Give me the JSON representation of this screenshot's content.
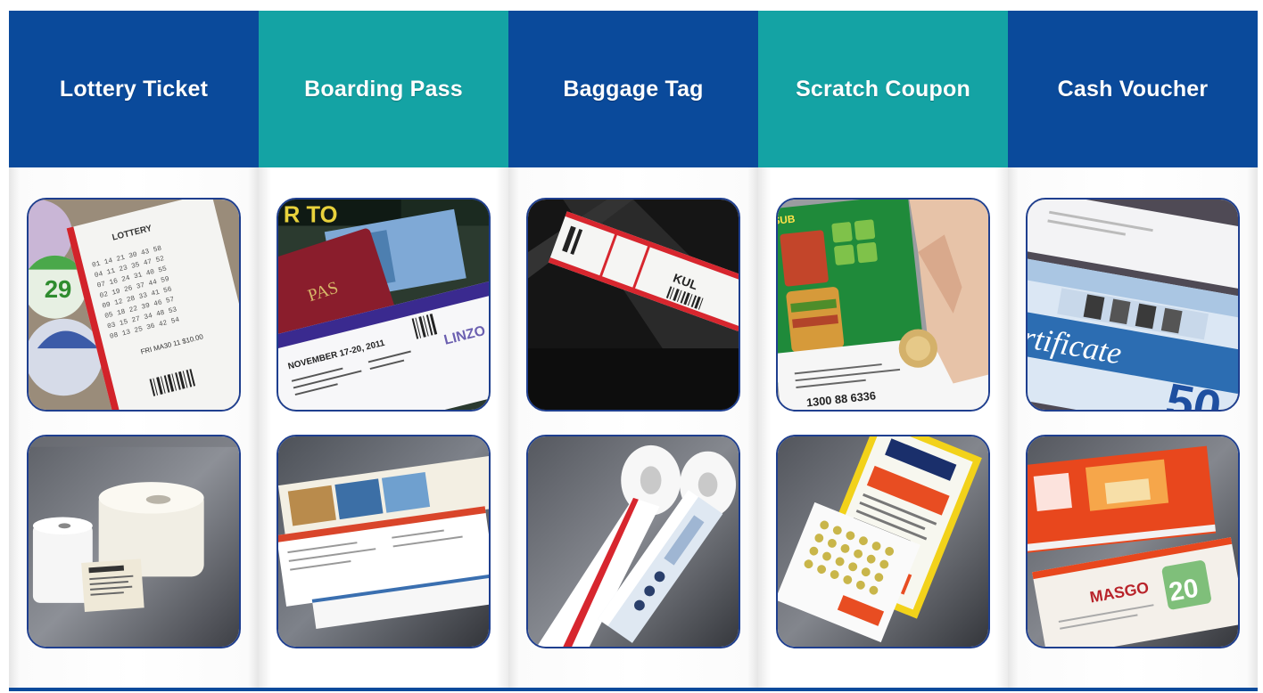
{
  "columns": [
    {
      "title": "Lottery Ticket",
      "header_color": "#0a4a9b",
      "top_image": {
        "ball_text": "29",
        "logo_text": "LOTTERY",
        "footer_text": "FRI MA30 11 $10.00"
      }
    },
    {
      "title": "Boarding Pass",
      "header_color": "#14a3a4",
      "top_image": {
        "passport_text": "PAS",
        "date_text": "NOVEMBER 17-20, 2011",
        "brand": "LINZO",
        "sign_text": "R TO"
      }
    },
    {
      "title": "Baggage Tag",
      "header_color": "#0a4a9b",
      "top_image": {
        "tag_code": "KUL"
      }
    },
    {
      "title": "Scratch Coupon",
      "header_color": "#14a3a4",
      "top_image": {
        "phone": "1300 88 6336",
        "brand": "SUB"
      }
    },
    {
      "title": "Cash Voucher",
      "header_color": "#0a4a9b",
      "top_image": {
        "cert_text": "rtificate",
        "amount": "50"
      },
      "bottom_image": {
        "brand": "MASGO",
        "amount": "20"
      }
    }
  ],
  "accent_colors": {
    "blue": "#0a4a9b",
    "teal": "#14a3a4",
    "tile_border": "#1f3f8f"
  }
}
